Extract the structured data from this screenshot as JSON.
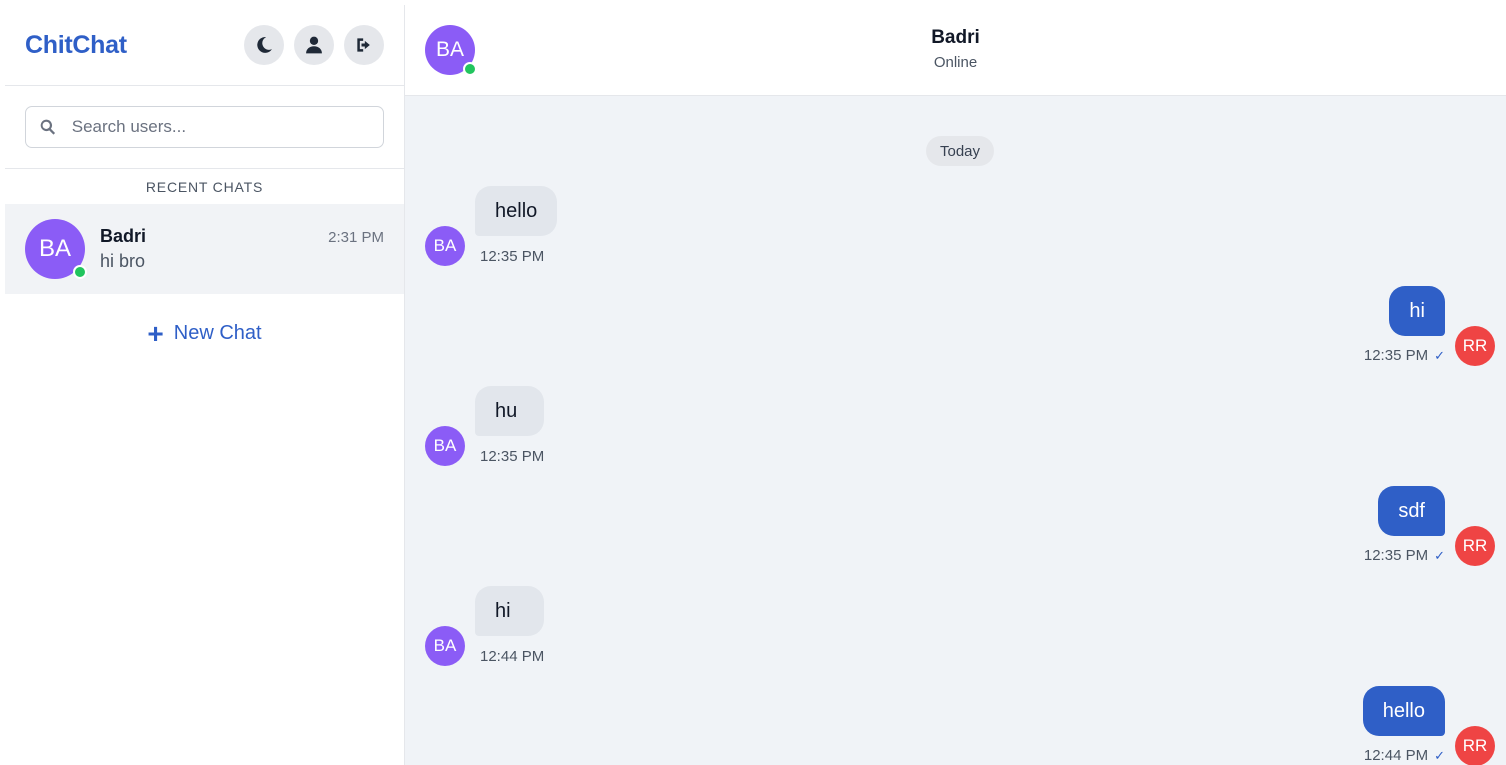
{
  "sidebar": {
    "brand": "ChitChat",
    "search_placeholder": "Search users...",
    "section_title": "RECENT CHATS",
    "chats": [
      {
        "initials": "BA",
        "name": "Badri",
        "time": "2:31 PM",
        "preview": "hi bro",
        "online": true
      }
    ],
    "new_chat_label": "New Chat",
    "icons": [
      "moon-icon",
      "user-icon",
      "sign-out-icon",
      "search-icon",
      "plus-icon"
    ]
  },
  "conversation": {
    "contact_initials": "BA",
    "contact_name": "Badri",
    "contact_status": "Online",
    "date_divider": "Today",
    "me_initials": "RR",
    "messages": [
      {
        "dir": "in",
        "text": "hello",
        "time": "12:35 PM"
      },
      {
        "dir": "out",
        "text": "hi",
        "time": "12:35 PM",
        "tick": "✓"
      },
      {
        "dir": "in",
        "text": "hu",
        "time": "12:35 PM"
      },
      {
        "dir": "out",
        "text": "sdf",
        "time": "12:35 PM",
        "tick": "✓"
      },
      {
        "dir": "in",
        "text": "hi",
        "time": "12:44 PM"
      },
      {
        "dir": "out",
        "text": "hello",
        "time": "12:44 PM",
        "tick": "✓"
      }
    ]
  },
  "colors": {
    "brand": "#2f5fc7",
    "avatar_contact": "#8b5cf6",
    "avatar_me": "#ef4444",
    "online": "#22c55e",
    "bubble_in": "#e2e6ec",
    "bubble_out": "#2f5fc7"
  }
}
